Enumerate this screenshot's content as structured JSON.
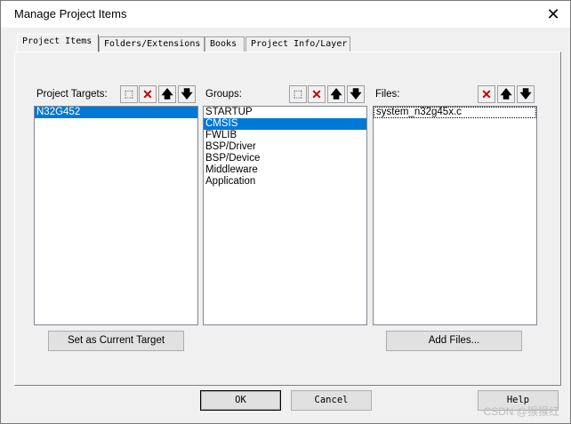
{
  "window": {
    "title": "Manage Project Items",
    "close_glyph": "✕"
  },
  "tabs": [
    {
      "label": "Project Items"
    },
    {
      "label": "Folders/Extensions"
    },
    {
      "label": "Books"
    },
    {
      "label": "Project Info/Layer"
    }
  ],
  "targets": {
    "label": "Project Targets:",
    "items": [
      "N32G452"
    ],
    "selected_index": 0,
    "button": "Set as Current Target"
  },
  "groups": {
    "label": "Groups:",
    "items": [
      "STARTUP",
      "CMSIS",
      "FWLIB",
      "BSP/Driver",
      "BSP/Device",
      "Middleware",
      "Application"
    ],
    "selected_index": 1
  },
  "files": {
    "label": "Files:",
    "items": [
      "system_n32g45x.c"
    ],
    "button": "Add Files..."
  },
  "toolbar_icons": {
    "new": "new-icon",
    "delete": "delete-icon",
    "up": "arrow-up-icon",
    "down": "arrow-down-icon"
  },
  "glyphs": {
    "new": "⬚",
    "delete": "✕",
    "up": "🡅",
    "down": "🡇"
  },
  "footer": {
    "ok": "OK",
    "cancel": "Cancel",
    "help": "Help"
  },
  "watermark": "CSDN @猴猴红"
}
